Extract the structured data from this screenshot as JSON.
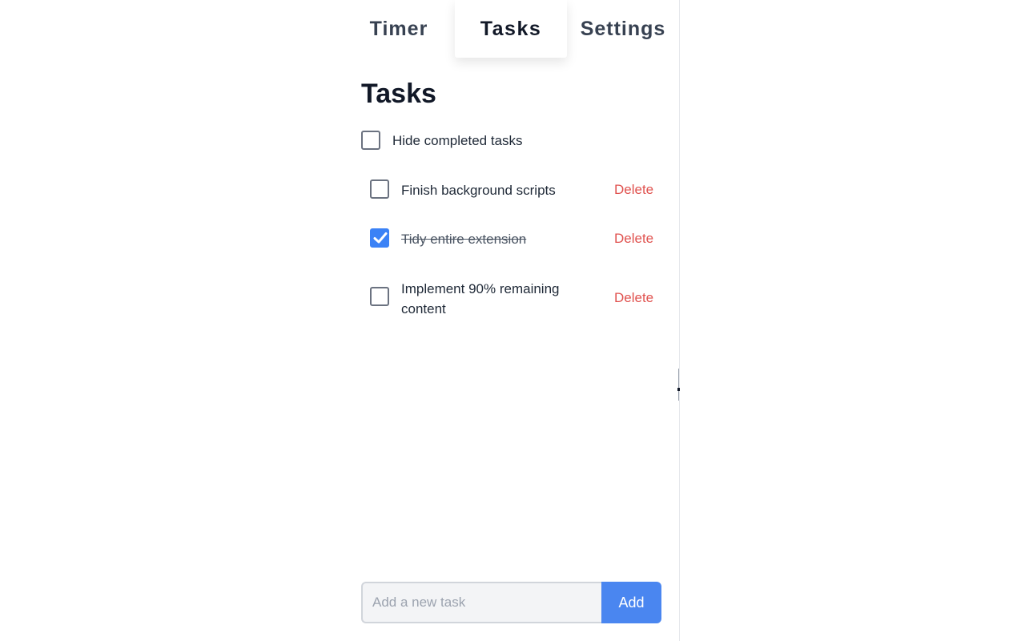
{
  "tabs": [
    {
      "label": "Timer",
      "active": false
    },
    {
      "label": "Tasks",
      "active": true
    },
    {
      "label": "Settings",
      "active": false
    }
  ],
  "main": {
    "heading": "Tasks",
    "hide_completed": {
      "label": "Hide completed tasks",
      "checked": false
    },
    "tasks": [
      {
        "label": "Finish background scripts",
        "done": false,
        "delete_label": "Delete"
      },
      {
        "label": "Tidy entire extension",
        "done": true,
        "delete_label": "Delete"
      },
      {
        "label": "Implement 90% remaining content",
        "done": false,
        "delete_label": "Delete"
      }
    ]
  },
  "add_form": {
    "placeholder": "Add a new task",
    "value": "",
    "button_label": "Add"
  },
  "colors": {
    "accent": "#3b82f6",
    "button": "#4a86f0",
    "delete": "#e0524f",
    "text": "#1f2937"
  },
  "icons": {
    "check": "check-icon"
  }
}
